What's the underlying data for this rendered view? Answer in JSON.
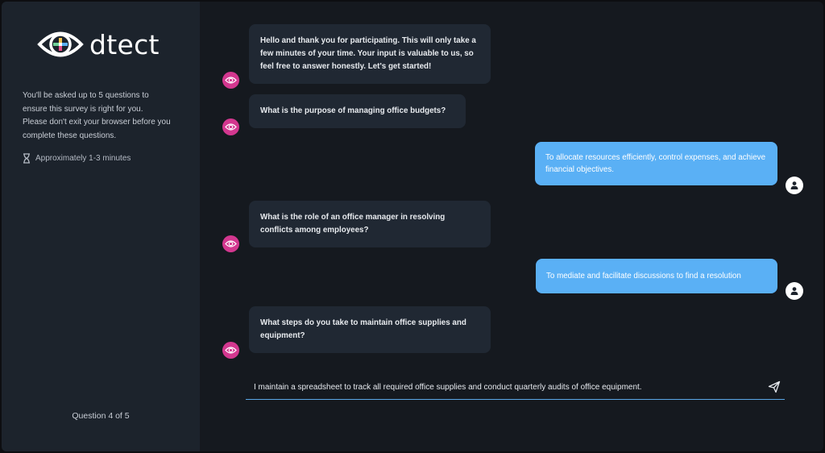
{
  "brand": {
    "name": "dtect"
  },
  "sidebar": {
    "intro_lines": [
      "You'll be asked up to 5 questions to",
      "ensure this survey is right for you.",
      "Please don't exit your browser before you",
      "complete these questions."
    ],
    "duration": "Approximately 1-3 minutes",
    "progress": "Question 4 of 5"
  },
  "messages": [
    {
      "from": "bot",
      "text": "Hello and thank you for participating. This will only take a few minutes of your time. Your input is valuable to us, so feel free to answer honestly. Let's get started!"
    },
    {
      "from": "bot",
      "text": "What is the purpose of managing office budgets?"
    },
    {
      "from": "user",
      "text": "To allocate resources efficiently, control expenses, and achieve financial objectives."
    },
    {
      "from": "bot",
      "text": "What is the role of an office manager in resolving conflicts among employees?"
    },
    {
      "from": "user",
      "text": "To mediate and facilitate discussions to find a resolution"
    },
    {
      "from": "bot",
      "text": "What steps do you take to maintain office supplies and equipment?"
    }
  ],
  "input": {
    "value": "I maintain a spreadsheet to track all required office supplies and conduct quarterly audits of office equipment."
  },
  "colors": {
    "accent_pink": "#d3378f",
    "user_bubble": "#5ab0f5",
    "input_underline": "#5aa7e6"
  },
  "icons": {
    "bot_avatar": "eye-icon",
    "user_avatar": "person-icon",
    "send": "send-icon",
    "duration": "hourglass-icon"
  }
}
